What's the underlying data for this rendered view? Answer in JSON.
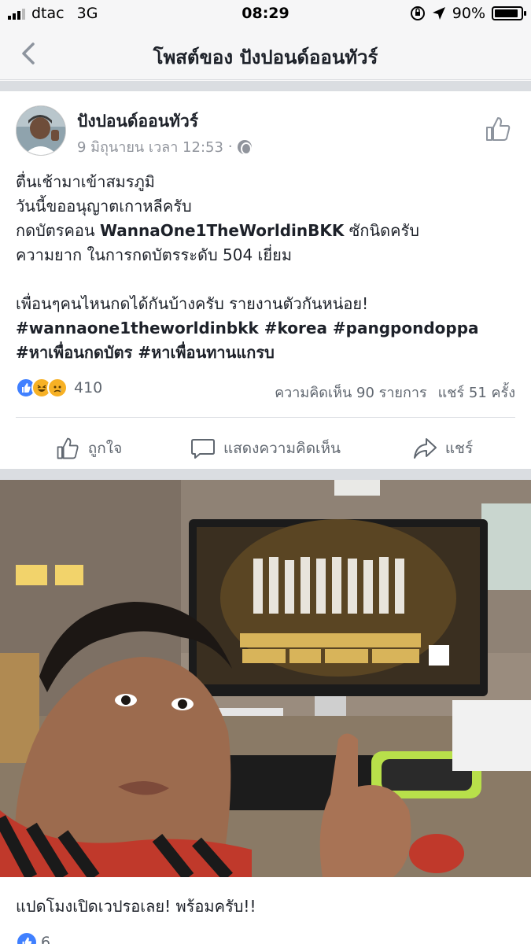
{
  "status_bar": {
    "carrier": "dtac",
    "network": "3G",
    "time": "08:29",
    "battery_text": "90%",
    "battery_level": 0.9
  },
  "nav": {
    "title": "โพสต์ของ ปังปอนด์ออนทัวร์",
    "back_icon": "chevron-left-icon"
  },
  "post": {
    "author": "ปังปอนด์ออนทัวร์",
    "date": "9 มิถุนายน เวลา 12:53",
    "separator": "·",
    "lines": [
      "ตื่นเช้ามาเข้าสมรภูมิ",
      "วันนี้ขออนุญาตเกาหลีครับ"
    ],
    "line3_prefix": "กดบัตรคอน ",
    "line3_bold": "WannaOne1TheWorldinBKK",
    "line3_suffix": " ซักนิดครับ",
    "line4": "ความยาก ในการกดบัตรระดับ 504 เยี่ยม",
    "line5": "เพื่อนๆคนไหนกดได้กันบ้างครับ รายงานตัวกันหน่อย!",
    "hashtags": "#wannaone1theworldinbkk #korea #pangpondoppa #หาเพื่อนกดบัตร #หาเพื่อนทานแกรบ",
    "reaction_count": "410",
    "comments": "ความคิดเห็น 90 รายการ",
    "shares": "แชร์ 51 ครั้ง",
    "actions": {
      "like": "ถูกใจ",
      "comment": "แสดงความคิดเห็น",
      "share": "แชร์"
    }
  },
  "photo": {
    "caption": "แปดโมงเปิดเวปรอเลย! พร้อมครับ!!",
    "reaction_count": "6"
  },
  "colors": {
    "fb_blue": "#4080ff",
    "emoji_yellow": "#f7b125",
    "text_gray": "#606770"
  }
}
